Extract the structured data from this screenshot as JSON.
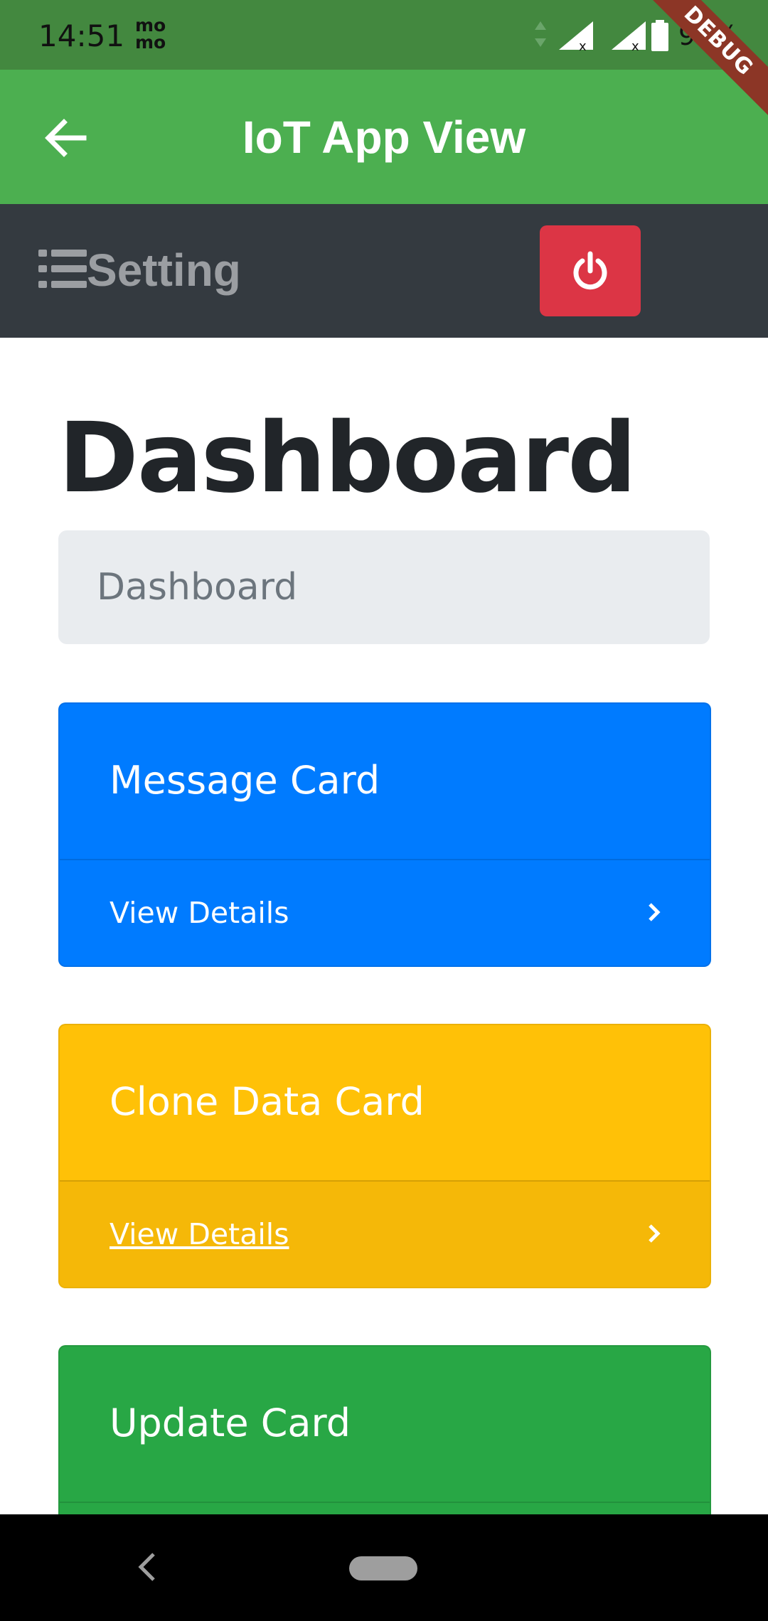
{
  "status_bar": {
    "time": "14:51",
    "app_icon": "momo-icon",
    "battery_percent": "92%"
  },
  "debug_banner": "DEBUG",
  "app_bar": {
    "title": "IoT App View",
    "back_icon": "arrow-left-icon"
  },
  "nav": {
    "menu_icon": "list-icon",
    "setting_label": "Setting",
    "power_icon": "power-icon",
    "power_color": "#dc3545"
  },
  "page": {
    "title": "Dashboard",
    "breadcrumb": "Dashboard"
  },
  "cards": [
    {
      "title": "Message Card",
      "footer": "View Details",
      "color": "#007bff"
    },
    {
      "title": "Clone Data Card",
      "footer": "View Details",
      "color": "#ffc107"
    },
    {
      "title": "Update Card",
      "footer": "",
      "color": "#28a745"
    }
  ],
  "colors": {
    "status_bar": "#43883f",
    "app_bar": "#4caf50",
    "nav_bar": "#343a40"
  }
}
